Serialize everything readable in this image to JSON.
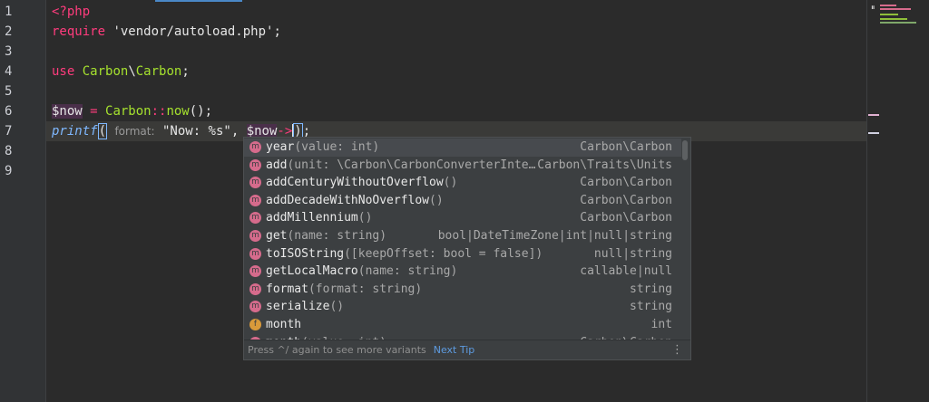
{
  "line_numbers": [
    "1",
    "2",
    "3",
    "4",
    "5",
    "6",
    "7",
    "8",
    "9"
  ],
  "code": {
    "l1_tag": "<?php",
    "l2_kw": "require",
    "l2_str": " 'vendor/autoload.php';",
    "l4_kw": "use",
    "l4_ns1": "Carbon",
    "l4_sep": "\\",
    "l4_ns2": "Carbon",
    "l4_end": ";",
    "l6_var": "$now",
    "l6_eq": " = ",
    "l6_cls": "Carbon",
    "l6_op": "::",
    "l6_fn": "now",
    "l6_end": "();",
    "l7_fn": "printf",
    "l7_open": "(",
    "l7_hint": "format:",
    "l7_str": "\"Now: %s\"",
    "l7_comma": ", ",
    "l7_var": "$now",
    "l7_arrow": "->",
    "l7_close": ")",
    "l7_end": ";"
  },
  "autocomplete": {
    "items": [
      {
        "kind": "m",
        "name": "year",
        "params": "(value: int)",
        "type": "Carbon\\Carbon"
      },
      {
        "kind": "m",
        "name": "add",
        "params": "(unit: \\Carbon\\CarbonConverterInte…",
        "type": "Carbon\\Traits\\Units"
      },
      {
        "kind": "m",
        "name": "addCenturyWithoutOverflow",
        "params": "()",
        "type": "Carbon\\Carbon"
      },
      {
        "kind": "m",
        "name": "addDecadeWithNoOverflow",
        "params": "()",
        "type": "Carbon\\Carbon"
      },
      {
        "kind": "m",
        "name": "addMillennium",
        "params": "()",
        "type": "Carbon\\Carbon"
      },
      {
        "kind": "m",
        "name": "get",
        "params": "(name: string)",
        "type": "bool|DateTimeZone|int|null|string"
      },
      {
        "kind": "m",
        "name": "toISOString",
        "params": "([keepOffset: bool = false])",
        "type": "null|string"
      },
      {
        "kind": "m",
        "name": "getLocalMacro",
        "params": "(name: string)",
        "type": "callable|null"
      },
      {
        "kind": "m",
        "name": "format",
        "params": "(format: string)",
        "type": "string"
      },
      {
        "kind": "m",
        "name": "serialize",
        "params": "()",
        "type": "string"
      },
      {
        "kind": "f",
        "name": "month",
        "params": "",
        "type": "int"
      },
      {
        "kind": "m",
        "name": "month",
        "params": "(value: int)",
        "type": "Carbon\\Carbon"
      }
    ],
    "footer_text": "Press ^/ again to see more variants",
    "next_tip": "Next Tip",
    "more_glyph": "⋮"
  },
  "colors": {
    "keyword": "#ff3c7d",
    "class": "#a6e22e",
    "function_italic": "#7fb8ff",
    "popup_bg": "#3c3f41",
    "editor_bg": "#2b2b2b"
  },
  "icons": {
    "method_badge": "m",
    "field_badge": "f",
    "pause": "⏸"
  }
}
